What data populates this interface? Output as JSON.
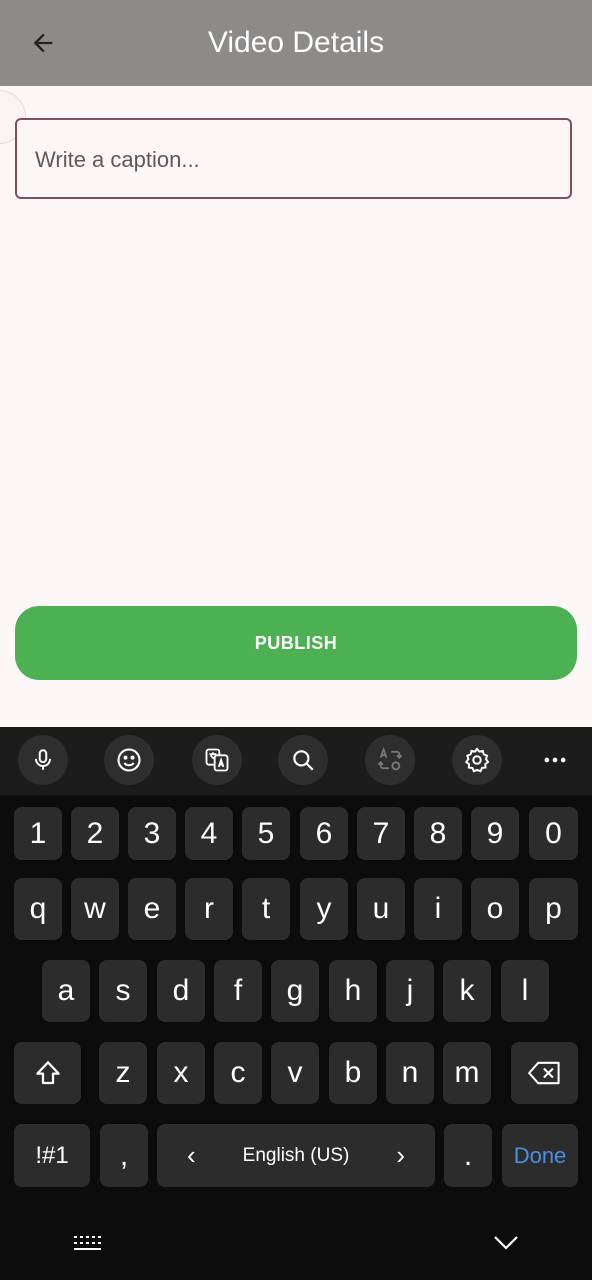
{
  "appbar": {
    "title": "Video Details",
    "back_icon": "arrow-back-icon"
  },
  "caption": {
    "placeholder": "Write a caption...",
    "value": ""
  },
  "publish": {
    "label": "PUBLISH",
    "color": "#4db153"
  },
  "keyboard": {
    "toolbar": [
      "microphone-icon",
      "emoji-icon",
      "translate-icon",
      "search-icon",
      "text-rotate-icon",
      "settings-icon",
      "more-icon"
    ],
    "number_row": [
      "1",
      "2",
      "3",
      "4",
      "5",
      "6",
      "7",
      "8",
      "9",
      "0"
    ],
    "row1": [
      "q",
      "w",
      "e",
      "r",
      "t",
      "y",
      "u",
      "i",
      "o",
      "p"
    ],
    "row2": [
      "a",
      "s",
      "d",
      "f",
      "g",
      "h",
      "j",
      "k",
      "l"
    ],
    "row3": [
      "z",
      "x",
      "c",
      "v",
      "b",
      "n",
      "m"
    ],
    "symbols_label": "!#1",
    "comma": ",",
    "language": "English (US)",
    "lang_prev": "‹",
    "lang_next": "›",
    "period": ".",
    "done_label": "Done"
  },
  "navbar": {
    "left_icon": "keyboard-icon",
    "right_icon": "chevron-down-icon"
  }
}
